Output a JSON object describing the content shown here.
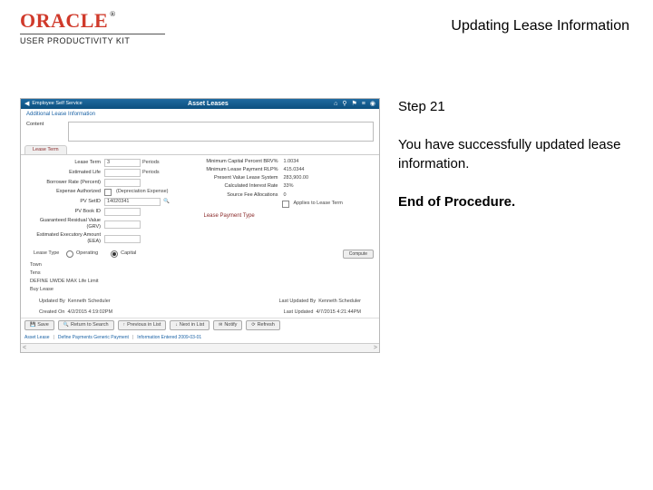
{
  "doc": {
    "title": "Updating Lease Information",
    "step_label": "Step 21",
    "body_text": "You have successfully updated lease information.",
    "end_text": "End of Procedure."
  },
  "brand": {
    "name": "ORACLE",
    "tm": "®",
    "sub": "USER PRODUCTIVITY KIT"
  },
  "app": {
    "titlebar": {
      "back_label": "Employee Self Service",
      "module_title": "Asset Leases",
      "icon_home": "⌂",
      "icon_search": "⚲",
      "icon_flag": "⚑",
      "icon_menu": "≡",
      "icon_help": "◉"
    },
    "section_head": "Additional Lease Information",
    "content_label": "Content",
    "tabs": {
      "lease_term": "Lease Term"
    },
    "left_fields": {
      "lease_term": {
        "label": "Lease Term",
        "value": "3",
        "unit": "Periods"
      },
      "est_life": {
        "label": "Estimated Life",
        "value": "",
        "unit": "Periods"
      },
      "borrow_rate": {
        "label": "Borrower Rate (Percent)",
        "value": ""
      },
      "exp_auth": {
        "label": "Expense Authorized",
        "value": "",
        "extra": "(Depreciation Expense)"
      },
      "pv_setid": {
        "label": "PV SetID",
        "value": "14020341"
      },
      "pv_book": {
        "label": "PV Book ID",
        "value": ""
      },
      "grv": {
        "label": "Guaranteed Residual Value (GRV)",
        "value": ""
      },
      "exec_amt": {
        "label": "Estimated Executory Amount (EEA)",
        "value": ""
      }
    },
    "right_fields": {
      "mcp_brv": {
        "label": "Minimum Capital Percent BRV%",
        "value": "1.0034"
      },
      "mlp_rlp": {
        "label": "Minimum Lease Payment RLP%",
        "value": "415.0344"
      },
      "pv_lease": {
        "label": "Present Value Lease System",
        "value": "283,900.00"
      },
      "calc_int": {
        "label": "Calculated Interest Rate",
        "value": "33%"
      },
      "src_fee": {
        "label": "Source Fee Allocations",
        "value": "0"
      },
      "chk_applies": "Applies to Lease Term"
    },
    "payment_section": "Lease Payment Type",
    "lease_type": {
      "label": "Lease Type",
      "operating": "Operating",
      "capital": "Capital"
    },
    "compute_btn": "Compute",
    "checks": {
      "town": "Town",
      "tens": "Tens",
      "define_uwde": "DEFINE UWDE MAX Life Limit",
      "buy_lease": "Buy Lease"
    },
    "meta": {
      "updated_by_label": "Updated By",
      "updated_by": "Kenneth Scheduler",
      "created_on_label": "Created On",
      "created_on": "4/2/2015 4:19:02PM",
      "last_updated_by_label": "Last Updated By",
      "last_updated_by": "Kenneth Scheduler",
      "last_updated_label": "Last Updated",
      "last_updated": "4/7/2015 4:21:44PM"
    },
    "buttons": {
      "save": "Save",
      "ret_search": "Return to Search",
      "previous": "Previous in List",
      "next": "Next in List",
      "notify": "Notify",
      "refresh": "Refresh"
    },
    "breadcrumb": {
      "p1": "Asset Lease",
      "p2": "Define Payments Generic Payment",
      "p3": "Information Entered 2009-03-01"
    }
  }
}
